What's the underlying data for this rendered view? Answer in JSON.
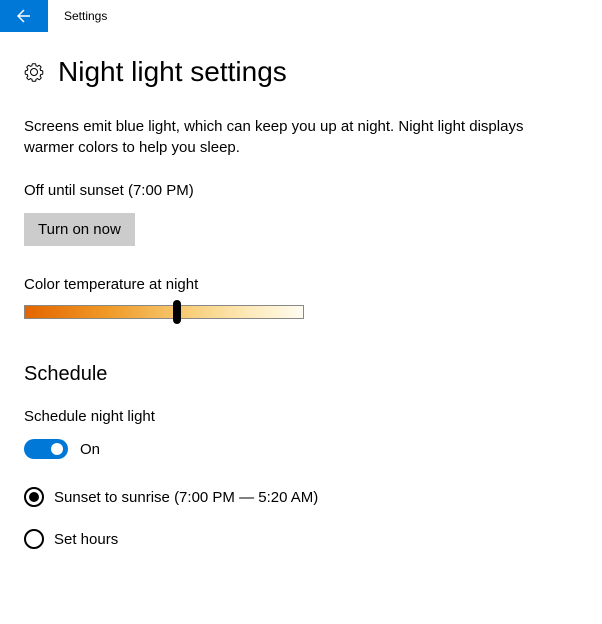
{
  "header": {
    "title": "Settings"
  },
  "page": {
    "title": "Night light settings",
    "description": "Screens emit blue light, which can keep you up at night. Night light displays warmer colors to help you sleep.",
    "status": "Off until sunset (7:00 PM)",
    "turn_on_label": "Turn on now"
  },
  "color_temp": {
    "label": "Color temperature at night"
  },
  "schedule": {
    "heading": "Schedule",
    "toggle_label": "Schedule night light",
    "toggle_state": "On",
    "options": [
      {
        "label": "Sunset to sunrise (7:00 PM — 5:20 AM)",
        "selected": true
      },
      {
        "label": "Set hours",
        "selected": false
      }
    ]
  }
}
